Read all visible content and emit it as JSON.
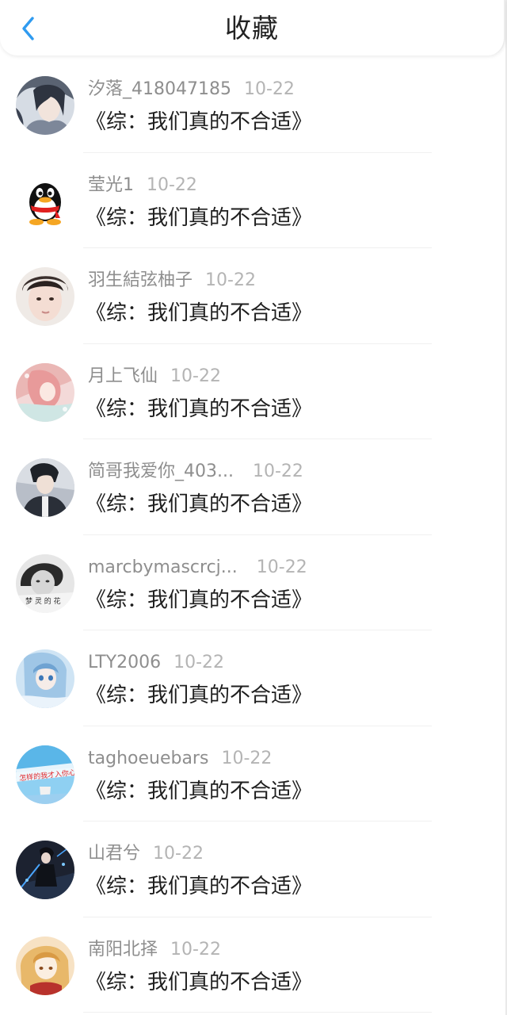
{
  "header": {
    "title": "收藏",
    "back_icon": "chevron-left-icon",
    "accent_color": "#2f9bf0"
  },
  "favorites": [
    {
      "user": "汐落_418047185",
      "date": "10-22",
      "book": "《综：我们真的不合适》",
      "avatar": "ink-portrait"
    },
    {
      "user": "莹光1",
      "date": "10-22",
      "book": "《综：我们真的不合适》",
      "avatar": "qq-penguin"
    },
    {
      "user": "羽生結弦柚子",
      "date": "10-22",
      "book": "《综：我们真的不合适》",
      "avatar": "face-photo"
    },
    {
      "user": "月上飞仙",
      "date": "10-22",
      "book": "《综：我们真的不合适》",
      "avatar": "pink-anime"
    },
    {
      "user": "简哥我爱你_403...",
      "date": "10-22",
      "book": "《综：我们真的不合适》",
      "avatar": "dark-anime"
    },
    {
      "user": "marcbymascrcj...",
      "date": "10-22",
      "book": "《综：我们真的不合适》",
      "avatar": "bw-photo"
    },
    {
      "user": "LTY2006",
      "date": "10-22",
      "book": "《综：我们真的不合适》",
      "avatar": "blue-anime"
    },
    {
      "user": "taghoeuebars",
      "date": "10-22",
      "book": "《综：我们真的不合适》",
      "avatar": "sky-meme"
    },
    {
      "user": "山君兮",
      "date": "10-22",
      "book": "《综：我们真的不合适》",
      "avatar": "night-anime"
    },
    {
      "user": "南阳北择",
      "date": "10-22",
      "book": "《综：我们真的不合适》",
      "avatar": "golden-anime"
    }
  ]
}
